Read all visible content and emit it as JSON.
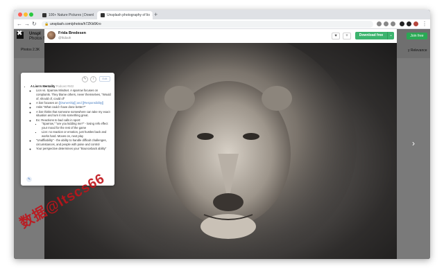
{
  "browser": {
    "tabs": [
      {
        "label": "100+ Nature Pictures | Downl",
        "active": false
      },
      {
        "label": "Unsplash photography of lio",
        "active": true
      }
    ],
    "address": "unsplash.com/photos/h7ZKk6Kro"
  },
  "site": {
    "name": "Unspl",
    "subname": "Photos f",
    "photos_tab": "Photos 2.3K",
    "join_label": "Join free",
    "relevance_label": "y Relevance"
  },
  "modal": {
    "author": "Frida Bredesen",
    "handle": "@fridooh",
    "like_glyph": "♥",
    "add_glyph": "+",
    "download_label": "Download free",
    "download_caret": "⌄",
    "next_glyph": "›",
    "close_glyph": "✖"
  },
  "notes": {
    "edit_label": "Edit",
    "items": [
      {
        "title": "A Lion's Mentality",
        "meta": " Podcast #502"
      },
      {
        "text": "Lion vs. Sparrow Mindset. A sparrow focuses on complaints. They blame others, never themselves, \"Would of, should of, could of\""
      },
      {
        "text": "A lion focuses on ",
        "tags": "[[Ownership]] and [[Responsibility]]"
      },
      {
        "text": "Asks \"What could I have done better?\""
      },
      {
        "text": "A lion thinks that someone somewhere can take my exact situation and turn it into something great."
      },
      {
        "text": "Ex: Reactions to bad calls in sport:",
        "sub": [
          "\"Sparrow,\" \"are you kidding me?\" - losing refs effect your mood for the rest of the game",
          "Lion: no reaction or emotion, just hustles back and works hard. Moves on, next play"
        ]
      },
      {
        "text": "\"Unaffliability\" - the ability to handle difficult challenges, circumstances, and people with poise and control"
      },
      {
        "text": "Your perspective determines your \"Bounceback ability\""
      }
    ],
    "pencil_glyph": "✎"
  },
  "watermark": "数据@ltscs66"
}
